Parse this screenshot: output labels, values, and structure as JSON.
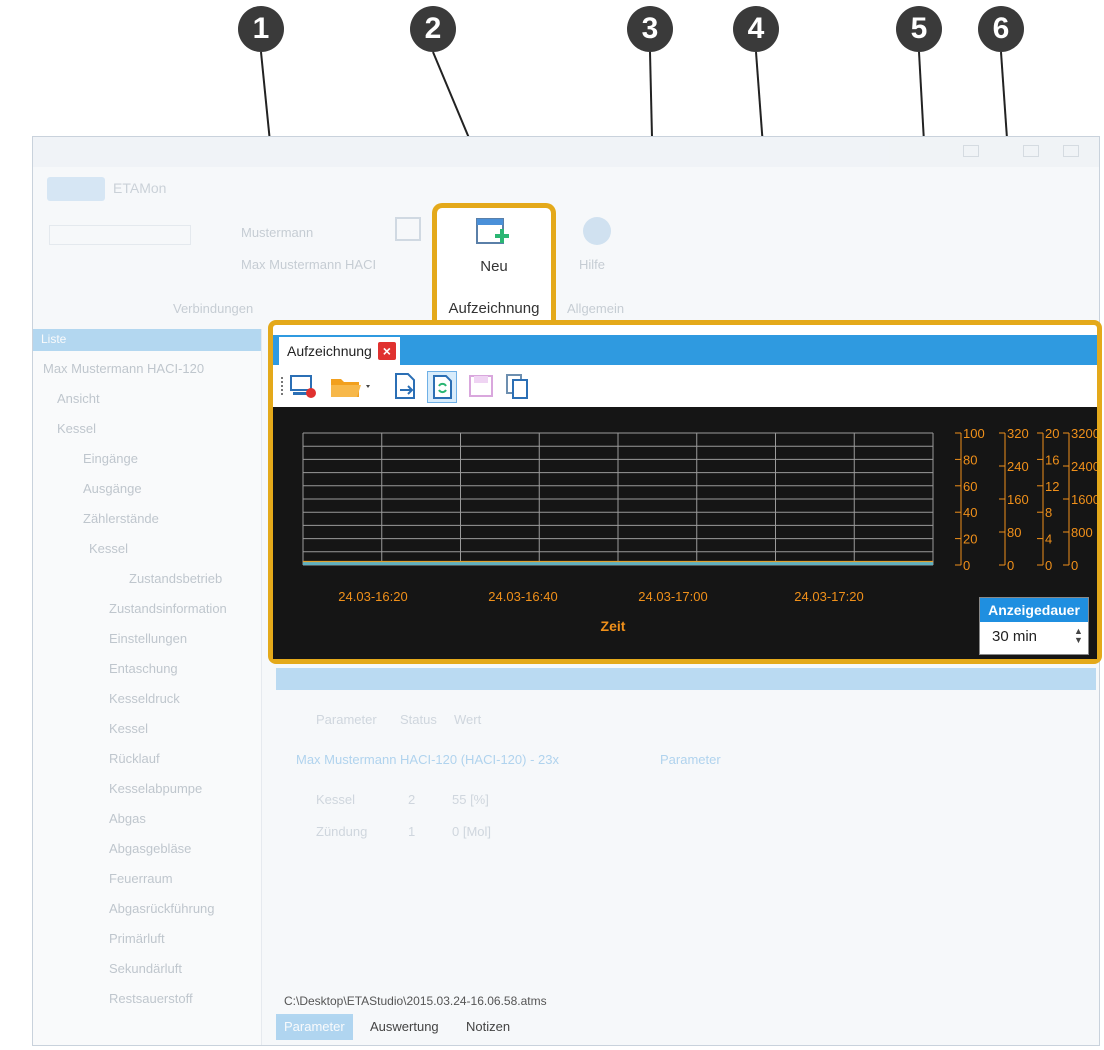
{
  "callouts": [
    "1",
    "2",
    "3",
    "4",
    "5",
    "6"
  ],
  "app": {
    "title": "ETAMon",
    "ribbon_faded": [
      "Mustermann",
      "Max Mustermann HACI",
      "Hilfe",
      "Verbindungen",
      "Allgemein"
    ],
    "tree_header": "Liste",
    "tree_items": [
      "Max Mustermann HACI-120",
      "Ansicht",
      "Kessel",
      "Eingänge",
      "Ausgänge",
      "Zählerstände",
      "Kessel",
      "Zustandsbetrieb",
      "Zustandsinformation",
      "Einstellungen",
      "Entaschung",
      "Kesseldruck",
      "Kessel",
      "Rücklauf",
      "Kesselabpumpe",
      "Abgas",
      "Abgasgebläse",
      "Feuerraum",
      "Abgasrückführung",
      "Primärluft",
      "Sekundärluft",
      "Restsauerstoff"
    ]
  },
  "ribbon": {
    "new_button_label": "Neu",
    "group_label": "Aufzeichnung"
  },
  "recording": {
    "tab_label": "Aufzeichnung",
    "close_icon": "×",
    "toolbar_icons": [
      "record-monitor-icon",
      "open-folder-icon",
      "export-icon",
      "refresh-icon",
      "save-icon",
      "copy-icon"
    ]
  },
  "chart_data": {
    "type": "line",
    "xlabel": "Zeit",
    "x_ticks": [
      "24.03-16:20",
      "24.03-16:40",
      "24.03-17:00",
      "24.03-17:20"
    ],
    "y_axes": [
      {
        "ticks": [
          "0",
          "20",
          "40",
          "60",
          "80",
          "100"
        ]
      },
      {
        "ticks": [
          "0",
          "80",
          "160",
          "240",
          "320"
        ]
      },
      {
        "ticks": [
          "0",
          "4",
          "8",
          "12",
          "16",
          "20"
        ]
      },
      {
        "ticks": [
          "0",
          "800",
          "1600",
          "2400",
          "3200"
        ]
      }
    ],
    "ylim": [
      0,
      100
    ],
    "grid": true,
    "series": [
      {
        "values": [
          2,
          2,
          2,
          2
        ],
        "color": "#e0a030"
      },
      {
        "values": [
          1,
          1,
          1,
          1
        ],
        "color": "#5fb0c0"
      }
    ],
    "axis_color": "#f0901a"
  },
  "display_duration": {
    "label": "Anzeigedauer",
    "value": "30 min"
  },
  "lower_panel": {
    "faded": [
      "Parameter",
      "Status",
      "Wert",
      "Max Mustermann HACI-120 (HACI-120) - 23x",
      "Parameter",
      "Kessel",
      "Zündung",
      "2",
      "1",
      "55 [%]",
      "0 [Mol]"
    ],
    "file_path": "C:\\Desktop\\ETAStudio\\2015.03.24-16.06.58.atms",
    "bottom_tabs": [
      "Parameter",
      "Auswertung",
      "Notizen"
    ]
  }
}
